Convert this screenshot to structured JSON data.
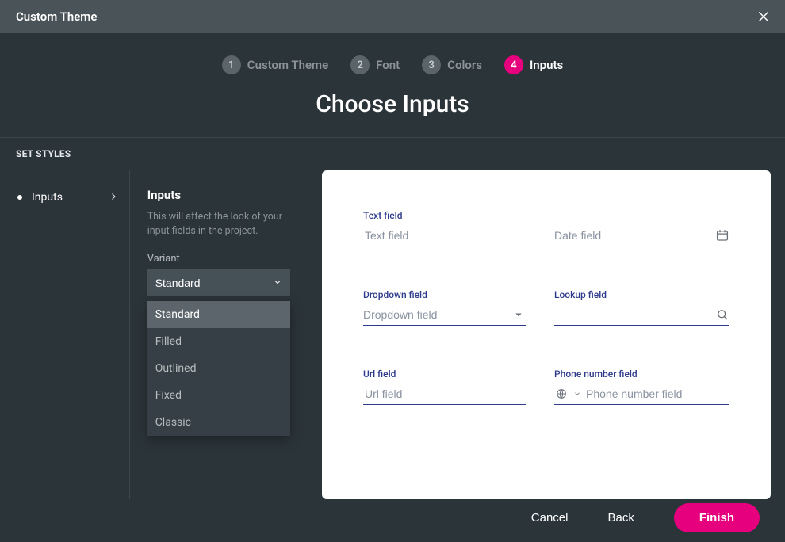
{
  "titlebar": {
    "title": "Custom Theme"
  },
  "steps": [
    {
      "num": "1",
      "label": "Custom Theme",
      "active": false
    },
    {
      "num": "2",
      "label": "Font",
      "active": false
    },
    {
      "num": "3",
      "label": "Colors",
      "active": false
    },
    {
      "num": "4",
      "label": "Inputs",
      "active": true
    }
  ],
  "page_title": "Choose Inputs",
  "setstyles_label": "SET STYLES",
  "left_nav": {
    "items": [
      {
        "label": "Inputs"
      }
    ]
  },
  "mid": {
    "heading": "Inputs",
    "description": "This will affect the look of your input fields in the project.",
    "variant_label": "Variant",
    "variant_selected": "Standard",
    "variant_options": [
      "Standard",
      "Filled",
      "Outlined",
      "Fixed",
      "Classic"
    ]
  },
  "preview": {
    "text": {
      "label": "Text field",
      "placeholder": "Text field"
    },
    "date": {
      "label": "",
      "placeholder": "Date field"
    },
    "dropdown": {
      "label": "Dropdown field",
      "placeholder": "Dropdown field"
    },
    "lookup": {
      "label": "Lookup field",
      "placeholder": ""
    },
    "url": {
      "label": "Url field",
      "placeholder": "Url field"
    },
    "phone": {
      "label": "Phone number field",
      "placeholder": "Phone number field"
    }
  },
  "footer": {
    "cancel": "Cancel",
    "back": "Back",
    "finish": "Finish"
  },
  "colors": {
    "accent": "#e6007e",
    "field_line": "#2e3a8c"
  }
}
